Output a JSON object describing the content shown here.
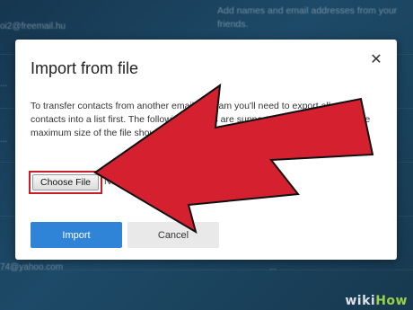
{
  "background": {
    "tip_text": "Add names and email addresses from your friends.",
    "email_fragment": "oi2@freemail.hu",
    "fragments": [
      "...",
      "...",
      "74@yahoo.com",
      "..."
    ]
  },
  "dialog": {
    "title": "Import from file",
    "close_glyph": "✕",
    "description": "To transfer contacts from another email program you'll need to export all your contacts into a list first. The following formats are supported: csv, vcf formats. The maximum size of the file should not exceed 1 MB.",
    "choose_file_label": "Choose File",
    "no_file_text": "No file chosen",
    "import_label": "Import",
    "cancel_label": "Cancel"
  },
  "colors": {
    "accent_blue": "#2f84d8",
    "highlight_red": "#c81e2a",
    "arrow_red": "#d5202f"
  },
  "watermark": {
    "prefix": "wiki",
    "suffix": "How"
  }
}
